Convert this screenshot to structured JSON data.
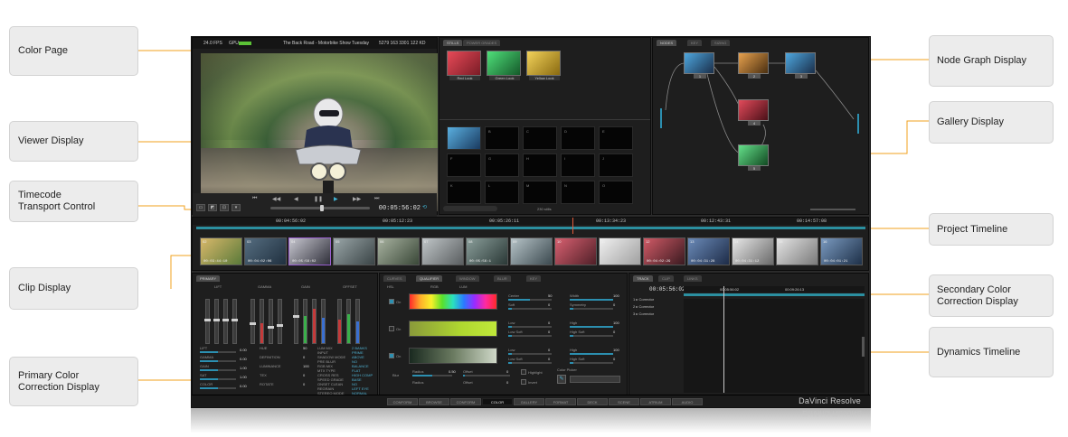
{
  "callouts": {
    "color_page": "Color Page",
    "viewer_display": "Viewer Display",
    "timecode_line1": "Timecode",
    "timecode_line2": "Transport Control",
    "clip_display": "Clip Display",
    "primary_line1": "Primary Color",
    "primary_line2": "Correction Display",
    "node_graph": "Node Graph Display",
    "gallery_display": "Gallery Display",
    "project_timeline": "Project Timeline",
    "secondary_line1": "Secondary Color",
    "secondary_line2": "Correction Display",
    "dynamics_timeline": "Dynamics Timeline"
  },
  "accent_color": "#f0a01e",
  "viewer": {
    "fps": "24.0 FPS",
    "gpu_label": "GPU",
    "clip_title": "The Back Road - Motorbike Show Tuesday",
    "clip_info": "5279 163 3301 122 KD",
    "timecode": "00:05:56:02",
    "transport_icons": [
      "skip-start-icon",
      "rewind-icon",
      "step-back-icon",
      "pause-icon",
      "play-icon",
      "fast-forward-icon",
      "skip-end-icon"
    ],
    "transport_glyphs": [
      "⏮",
      "◀◀",
      "◀",
      "❚❚",
      "▶",
      "▶▶",
      "⏭"
    ]
  },
  "gallery": {
    "tabs": [
      "STILLS",
      "POWER GRADES"
    ],
    "stills": [
      "Red Look",
      "Green Look",
      "Yellow Look"
    ],
    "slots": [
      "",
      "B",
      "C",
      "D",
      "E",
      "F",
      "G",
      "H",
      "I",
      "J",
      "K",
      "L",
      "M",
      "N",
      "O"
    ],
    "footer": "230 stills"
  },
  "node_graph": {
    "tabs": [
      "NODES",
      "KEY",
      "SIZING"
    ],
    "nodes": [
      "1",
      "2",
      "3",
      "4",
      "5"
    ]
  },
  "timeline": {
    "ruler": [
      "00:04:56:02",
      "00:05:12:23",
      "00:05:26:11",
      "00:13:34:23",
      "00:12:43:31",
      "00:14:57:08"
    ],
    "clips": [
      {
        "num": "02",
        "tc": "00:03:44:10"
      },
      {
        "num": "03",
        "tc": "00:04:02:06"
      },
      {
        "num": "04",
        "tc": "00:05:56:02"
      },
      {
        "num": "05",
        "tc": ""
      },
      {
        "num": "06",
        "tc": ""
      },
      {
        "num": "07",
        "tc": ""
      },
      {
        "num": "08",
        "tc": "00:05:56:1"
      },
      {
        "num": "09",
        "tc": ""
      },
      {
        "num": "10",
        "tc": ""
      },
      {
        "num": "11",
        "tc": ""
      },
      {
        "num": "12",
        "tc": "00:04:02:29"
      },
      {
        "num": "13",
        "tc": "00:04:31:28"
      },
      {
        "num": "14",
        "tc": "00:04:31:12"
      },
      {
        "num": "15",
        "tc": ""
      },
      {
        "num": "16",
        "tc": "00:04:01:21"
      }
    ]
  },
  "primary": {
    "tab": "PRIMARY",
    "groups": [
      "LIFT",
      "GAMMA",
      "GAIN",
      "OFFSET"
    ],
    "params_left": [
      {
        "label": "LIFT",
        "value": "0.00"
      },
      {
        "label": "GAMMA",
        "value": "0.00"
      },
      {
        "label": "GAIN",
        "value": "1.00"
      },
      {
        "label": "SAT",
        "value": "1.00"
      },
      {
        "label": "COLOR",
        "value": "0.00"
      }
    ],
    "params_mid": [
      {
        "label": "HUE",
        "value": "50"
      },
      {
        "label": "DEFINITION",
        "value": "0"
      },
      {
        "label": "LUMINANCE",
        "value": "100"
      },
      {
        "label": "TEX",
        "value": "0"
      },
      {
        "label": "ROTATE",
        "value": "0"
      }
    ],
    "params_right": [
      {
        "label": "LUM MIX",
        "value": "2 BANKS"
      },
      {
        "label": "INPUT",
        "value": "PRIME"
      },
      {
        "label": "SHADOW MODE",
        "value": "ABOVE"
      },
      {
        "label": "PRE BLUR",
        "value": "NO"
      },
      {
        "label": "RGB MIX",
        "value": "BALANCE"
      },
      {
        "label": "MTX TYPE",
        "value": "FLAT"
      },
      {
        "label": "CROSS RES",
        "value": "HIGH COMP"
      },
      {
        "label": "SPEED GRADE",
        "value": "BASE"
      },
      {
        "label": "ONSET CLEAN",
        "value": "NO"
      },
      {
        "label": "REGRAIN",
        "value": "LEFT EYE"
      },
      {
        "label": "STEREO MODE",
        "value": "NORMAL"
      }
    ]
  },
  "secondary": {
    "tabs": [
      "CURVES",
      "QUALIFIER",
      "WINDOW",
      "BLUR",
      "KEY"
    ],
    "sub_tabs": [
      "HSL",
      "RGB",
      "LUM"
    ],
    "rows": [
      "On",
      "On",
      "On"
    ],
    "controls_center": [
      {
        "label": "Center",
        "value": "50"
      },
      {
        "label": "Soft",
        "value": "0"
      },
      {
        "label": "Low",
        "value": "0"
      },
      {
        "label": "Low Soft",
        "value": "0"
      },
      {
        "label": "Low",
        "value": "0"
      },
      {
        "label": "Low Soft",
        "value": "0"
      }
    ],
    "controls_right": [
      {
        "label": "Width",
        "value": "100"
      },
      {
        "label": "Symmetry",
        "value": "0"
      },
      {
        "label": "High",
        "value": "100"
      },
      {
        "label": "High Soft",
        "value": "0"
      },
      {
        "label": "High",
        "value": "100"
      },
      {
        "label": "High Soft",
        "value": "0"
      }
    ],
    "blur_labels": [
      "Blur",
      "Radius",
      "Offset",
      "Radius",
      "Offset"
    ],
    "blur_values": [
      "0.50",
      "0",
      "0"
    ],
    "toggles": [
      "Highlight",
      "Invert"
    ],
    "picker_label": "Color Picker"
  },
  "dynamics": {
    "tabs": [
      "TRACK",
      "CLIP",
      "LINKS"
    ],
    "timecode": "00:05:56:02",
    "timecode2": "00:05:56:02",
    "timecode3": "00:09:26:13",
    "tracks": [
      "1 ▸ Corrector",
      "2 ▸ Corrector",
      "3 ▸ Corrector"
    ]
  },
  "pages": [
    "CONFORM",
    "BROWSE",
    "CONFORM",
    "COLOR",
    "GALLERY",
    "FORMAT",
    "DECK",
    "SCENE",
    "ATRIUM",
    "AUDIO"
  ],
  "active_page_index": 3,
  "brand": "DaVinci Resolve"
}
